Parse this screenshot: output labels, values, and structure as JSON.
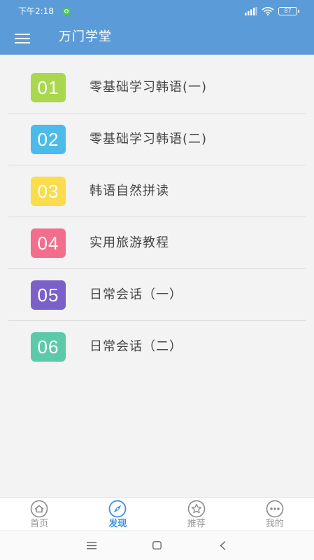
{
  "status_bar": {
    "time": "下午2:18",
    "battery": "87",
    "icons": [
      "notification-app-icon",
      "signal-icon",
      "wifi-icon",
      "battery-icon"
    ]
  },
  "app_bar": {
    "menu_icon": "hamburger-menu-icon",
    "title": "万门学堂"
  },
  "theme": {
    "header_bg": "#5b9bd8",
    "accent": "#3b8fe3",
    "text": "#444444",
    "inactive": "#8a8a8a"
  },
  "courses": [
    {
      "number": "01",
      "title": "零基础学习韩语(一)",
      "color": "#a9d84f"
    },
    {
      "number": "02",
      "title": "零基础学习韩语(二)",
      "color": "#4cbbe9"
    },
    {
      "number": "03",
      "title": "韩语自然拼读",
      "color": "#fadc4c"
    },
    {
      "number": "04",
      "title": "实用旅游教程",
      "color": "#f36e8d"
    },
    {
      "number": "05",
      "title": "日常会话（一）",
      "color": "#7b60c9"
    },
    {
      "number": "06",
      "title": "日常会话（二）",
      "color": "#5ccaa9"
    }
  ],
  "bottom_nav": [
    {
      "label": "首页",
      "icon": "home-icon",
      "active": false
    },
    {
      "label": "发现",
      "icon": "compass-icon",
      "active": true
    },
    {
      "label": "推荐",
      "icon": "star-icon",
      "active": false
    },
    {
      "label": "我的",
      "icon": "more-icon",
      "active": false
    }
  ],
  "system_nav": {
    "icons": [
      "recent-apps-icon",
      "home-button-icon",
      "back-icon"
    ]
  }
}
